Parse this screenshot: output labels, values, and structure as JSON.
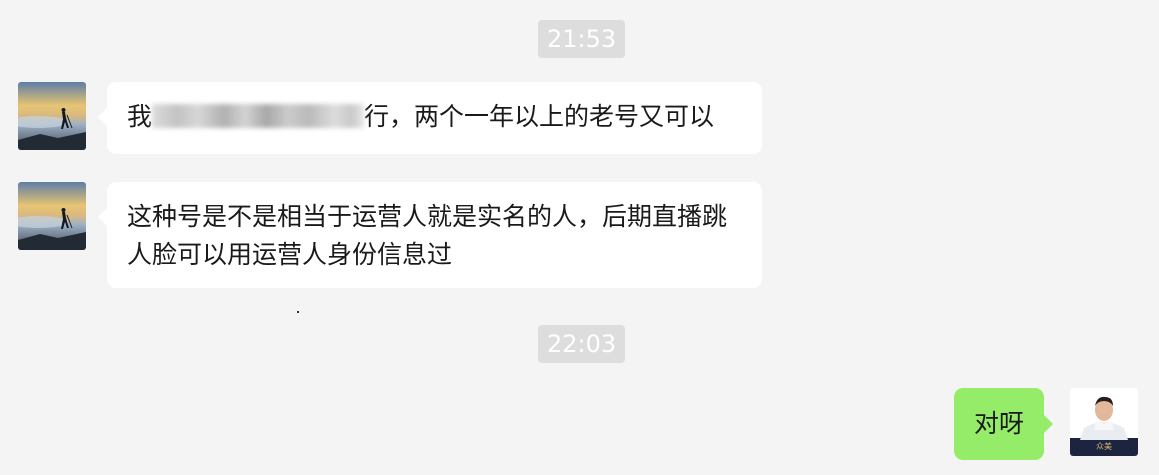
{
  "timestamps": [
    "21:53",
    "22:03"
  ],
  "messages": [
    {
      "sender": "other",
      "text_before": "我",
      "text_after": "行，两个一年以上的老号又可以"
    },
    {
      "sender": "other",
      "text": "这种号是不是相当于运营人就是实名的人，后期直播跳人脸可以用运营人身份信息过"
    },
    {
      "sender": "self",
      "text": "对呀"
    }
  ],
  "self_avatar_caption": "众美",
  "colors": {
    "background": "#f4f4f4",
    "timestamp_bg": "#dddddd",
    "incoming_bubble": "#ffffff",
    "outgoing_bubble": "#95ec69"
  },
  "icons": {
    "other_avatar": "landscape-hiker-avatar",
    "self_avatar": "person-photo-avatar",
    "redaction": "blurred-text-block"
  }
}
